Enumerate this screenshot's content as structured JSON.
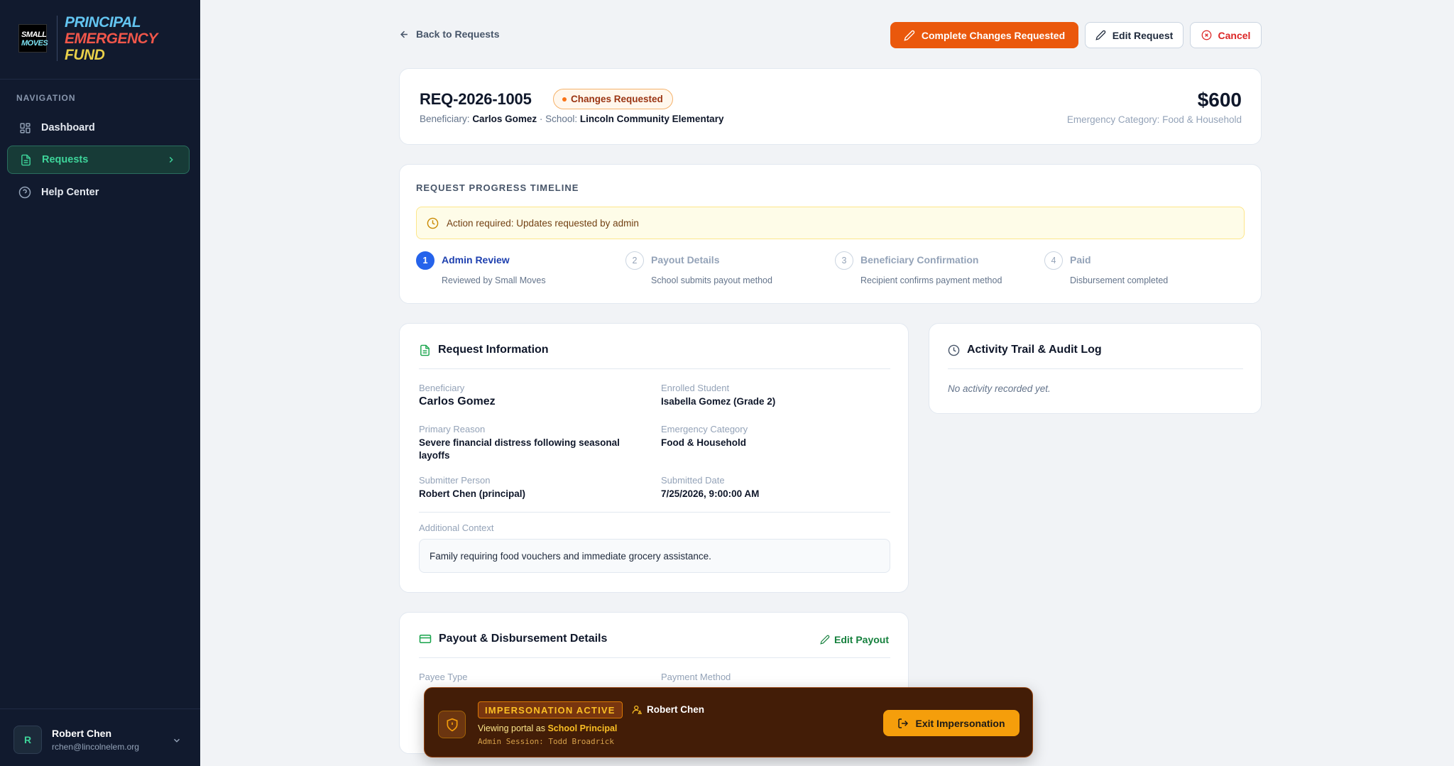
{
  "brand": {
    "logo_line1": "SMALL",
    "logo_line2": "MOVES",
    "title_1": "PRINCIPAL",
    "title_2": "EMERGENCY",
    "title_3": "FUND"
  },
  "sidebar": {
    "nav_label": "NAVIGATION",
    "items": [
      {
        "label": "Dashboard",
        "icon": "grid-icon"
      },
      {
        "label": "Requests",
        "icon": "document-icon",
        "active": true
      },
      {
        "label": "Help Center",
        "icon": "help-circle-icon"
      }
    ],
    "user": {
      "initial": "R",
      "name": "Robert Chen",
      "email": "rchen@lincolnelem.org"
    }
  },
  "toolbar": {
    "back_label": "Back to Requests",
    "complete_label": "Complete Changes Requested",
    "edit_label": "Edit Request",
    "cancel_label": "Cancel"
  },
  "request": {
    "id": "REQ-2026-1005",
    "status": "Changes Requested",
    "beneficiary_label": "Beneficiary:",
    "beneficiary": "Carlos Gomez",
    "school_label": "School:",
    "school": "Lincoln Community Elementary",
    "separator": "·",
    "amount": "$600",
    "category_line": "Emergency Category: Food & Household"
  },
  "timeline": {
    "title": "REQUEST PROGRESS TIMELINE",
    "alert": "Action required: Updates requested by admin",
    "steps": [
      {
        "num": "1",
        "title": "Admin Review",
        "sub": "Reviewed by Small Moves"
      },
      {
        "num": "2",
        "title": "Payout Details",
        "sub": "School submits payout method"
      },
      {
        "num": "3",
        "title": "Beneficiary Confirmation",
        "sub": "Recipient confirms payment method"
      },
      {
        "num": "4",
        "title": "Paid",
        "sub": "Disbursement completed"
      }
    ]
  },
  "info": {
    "title": "Request Information",
    "fields": [
      {
        "label": "Beneficiary",
        "value": "Carlos Gomez"
      },
      {
        "label": "Enrolled Student",
        "value": "Isabella Gomez (Grade 2)"
      },
      {
        "label": "Primary Reason",
        "value": "Severe financial distress following seasonal layoffs"
      },
      {
        "label": "Emergency Category",
        "value": "Food & Household"
      },
      {
        "label": "Submitter Person",
        "value": "Robert Chen (principal)"
      },
      {
        "label": "Submitted Date",
        "value": "7/25/2026, 9:00:00 AM"
      }
    ],
    "context_label": "Additional Context",
    "context": "Family requiring food vouchers and immediate grocery assistance."
  },
  "activity": {
    "title": "Activity Trail & Audit Log",
    "empty": "No activity recorded yet."
  },
  "payout": {
    "title": "Payout & Disbursement Details",
    "edit_label": "Edit Payout",
    "payee_type_label": "Payee Type",
    "payment_method_label": "Payment Method"
  },
  "impersonation": {
    "tag": "IMPERSONATION ACTIVE",
    "user": "Robert Chen",
    "viewing_prefix": "Viewing portal as",
    "role": "School Principal",
    "admin_session": "Admin Session: Todd Broadrick",
    "exit_label": "Exit Impersonation"
  }
}
